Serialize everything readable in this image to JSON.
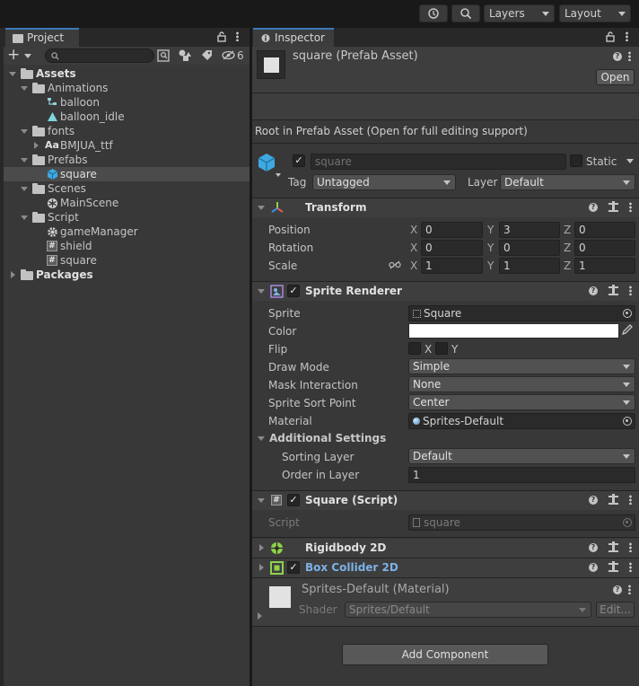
{
  "toolbar": {
    "layers_label": "Layers",
    "layout_label": "Layout"
  },
  "project": {
    "tab_title": "Project",
    "add_label": "+",
    "search_placeholder": "",
    "hidden_count": "6",
    "tree": [
      {
        "label": "Assets",
        "bold": true
      },
      {
        "label": "Animations"
      },
      {
        "label": "balloon"
      },
      {
        "label": "balloon_idle"
      },
      {
        "label": "fonts"
      },
      {
        "label": "BMJUA_ttf",
        "prefix": "Aa"
      },
      {
        "label": "Prefabs"
      },
      {
        "label": "square",
        "selected": true
      },
      {
        "label": "Scenes"
      },
      {
        "label": "MainScene"
      },
      {
        "label": "Script"
      },
      {
        "label": "gameManager"
      },
      {
        "label": "shield"
      },
      {
        "label": "square"
      },
      {
        "label": "Packages",
        "bold": true
      }
    ]
  },
  "inspector": {
    "tab_title": "Inspector",
    "asset_title": "square (Prefab Asset)",
    "open_label": "Open",
    "root_notice": "Root in Prefab Asset (Open for full editing support)",
    "object_name": "square",
    "static_label": "Static",
    "tag_label": "Tag",
    "tag_value": "Untagged",
    "layer_label": "Layer",
    "layer_value": "Default",
    "transform": {
      "title": "Transform",
      "position_label": "Position",
      "rotation_label": "Rotation",
      "scale_label": "Scale",
      "axis_x": "X",
      "axis_y": "Y",
      "axis_z": "Z",
      "position": [
        "0",
        "3",
        "0"
      ],
      "rotation": [
        "0",
        "0",
        "0"
      ],
      "scale": [
        "1",
        "1",
        "1"
      ]
    },
    "sprite_renderer": {
      "title": "Sprite Renderer",
      "sprite_label": "Sprite",
      "sprite_value": "Square",
      "color_label": "Color",
      "color_value": "#ffffff",
      "flip_label": "Flip",
      "flip_x": "X",
      "flip_y": "Y",
      "draw_mode_label": "Draw Mode",
      "draw_mode_value": "Simple",
      "mask_label": "Mask Interaction",
      "mask_value": "None",
      "sort_point_label": "Sprite Sort Point",
      "sort_point_value": "Center",
      "material_label": "Material",
      "material_value": "Sprites-Default",
      "additional_label": "Additional Settings",
      "sorting_layer_label": "Sorting Layer",
      "sorting_layer_value": "Default",
      "order_label": "Order in Layer",
      "order_value": "1"
    },
    "square_script": {
      "title": "Square (Script)",
      "script_label": "Script",
      "script_value": "square"
    },
    "rigidbody": {
      "title": "Rigidbody 2D"
    },
    "box_collider": {
      "title": "Box Collider 2D"
    },
    "material_preview": {
      "title": "Sprites-Default (Material)",
      "shader_label": "Shader",
      "shader_value": "Sprites/Default",
      "edit_label": "Edit..."
    },
    "add_component_label": "Add Component"
  }
}
